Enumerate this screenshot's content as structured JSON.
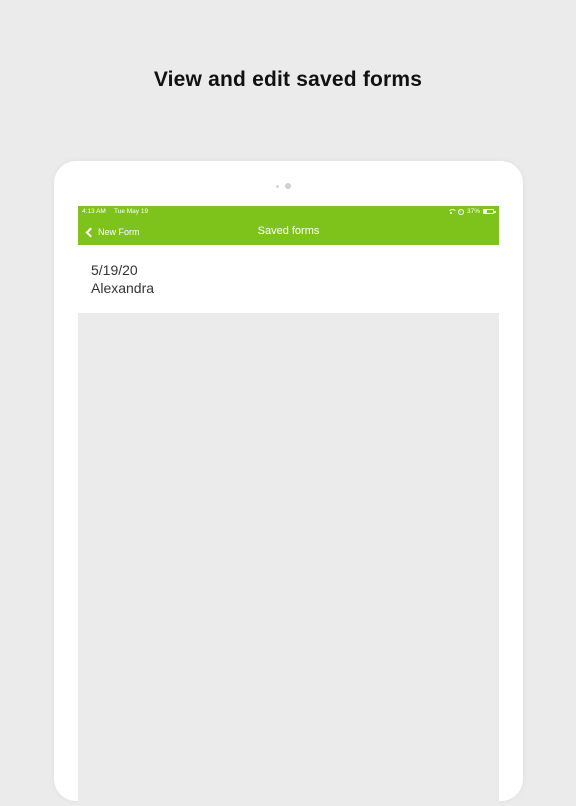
{
  "caption": "View and edit saved forms",
  "status_bar": {
    "time": "4:13 AM",
    "date": "Tue May 19",
    "battery_text": "37%",
    "battery_level": 0.37
  },
  "nav": {
    "back_label": "New Form",
    "title": "Saved forms"
  },
  "saved_forms": [
    {
      "date": "5/19/20",
      "name": "Alexandra"
    }
  ],
  "colors": {
    "accent": "#7ec31c",
    "background": "#ebebeb"
  }
}
